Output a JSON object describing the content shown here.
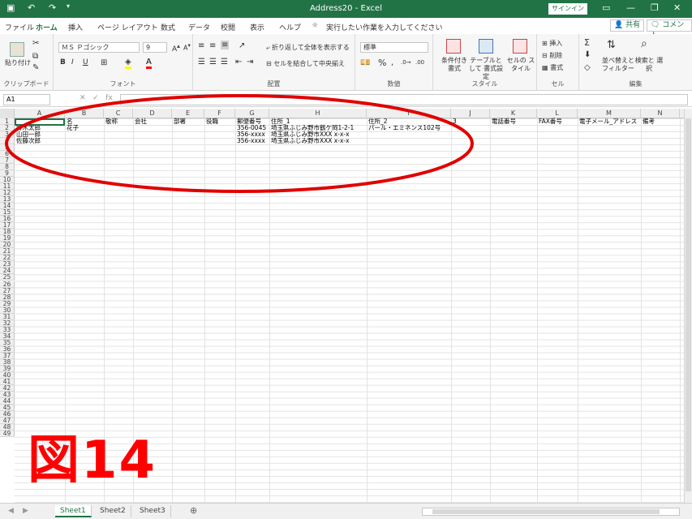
{
  "window": {
    "title": "Address20 - Excel",
    "signin": "サインイン"
  },
  "tabs": [
    "ファイル",
    "ホーム",
    "挿入",
    "ページ レイアウト",
    "数式",
    "データ",
    "校閲",
    "表示",
    "ヘルプ"
  ],
  "tell_me": "実行したい作業を入力してください",
  "share": "共有",
  "comment": "コメント",
  "ribbon": {
    "clipboard": {
      "label": "クリップボード",
      "paste": "貼り付け"
    },
    "font": {
      "label": "フォント",
      "name": "ＭＳ Ｐゴシック",
      "size": "9",
      "bold": "B",
      "italic": "I",
      "underline": "U"
    },
    "alignment": {
      "label": "配置",
      "wrap": "折り返して全体を表示する",
      "merge": "セルを結合して中央揃え"
    },
    "number": {
      "label": "数値",
      "format": "標準",
      "percent": "%"
    },
    "styles": {
      "label": "スタイル",
      "conditional": "条件付き 書式",
      "table": "テーブルとして 書式設定",
      "cell": "セルの スタイル"
    },
    "cells": {
      "label": "セル",
      "insert": "挿入",
      "delete": "削除",
      "format": "書式"
    },
    "editing": {
      "label": "編集",
      "sort": "並べ替えと フィルター",
      "find": "検索と 選択"
    }
  },
  "namebox": "A1",
  "fx": "fx",
  "columns": [
    "A",
    "B",
    "C",
    "D",
    "E",
    "F",
    "G",
    "H",
    "I",
    "J",
    "K",
    "L",
    "M",
    "N"
  ],
  "row_count": 49,
  "cells": {
    "A1": "",
    "B1": "名",
    "C1": "敬称",
    "D1": "会社",
    "E1": "部署",
    "F1": "役職",
    "G1": "郵便番号",
    "H1": "住所_1",
    "I1": "住所_2",
    "J1": "3",
    "K1": "電話番号",
    "L1": "FAX番号",
    "M1": "電子メール_アドレス",
    "N1": "備考",
    "A2": "鈴木太郎",
    "B2": "花子",
    "G2": "356-0045",
    "H2": "埼玉県ふじみ野市鶴ケ岡1-2-1",
    "I2": "パール・エミネンス102号",
    "A3": "山田一郎",
    "G3": "356-xxxx",
    "H3": "埼玉県ふじみ野市XXX x-x-x",
    "A4": "佐藤次郎",
    "G4": "356-xxxx",
    "H4": "埼玉県ふじみ野市XXX x-x-x"
  },
  "sheets": [
    {
      "name": "Sheet1",
      "active": true
    },
    {
      "name": "Sheet2",
      "active": false
    },
    {
      "name": "Sheet3",
      "active": false
    }
  ],
  "annotation": {
    "label": "図14",
    "color": "#ff0000"
  },
  "colors": {
    "accent": "#217346",
    "annotation": "#ff0000"
  }
}
